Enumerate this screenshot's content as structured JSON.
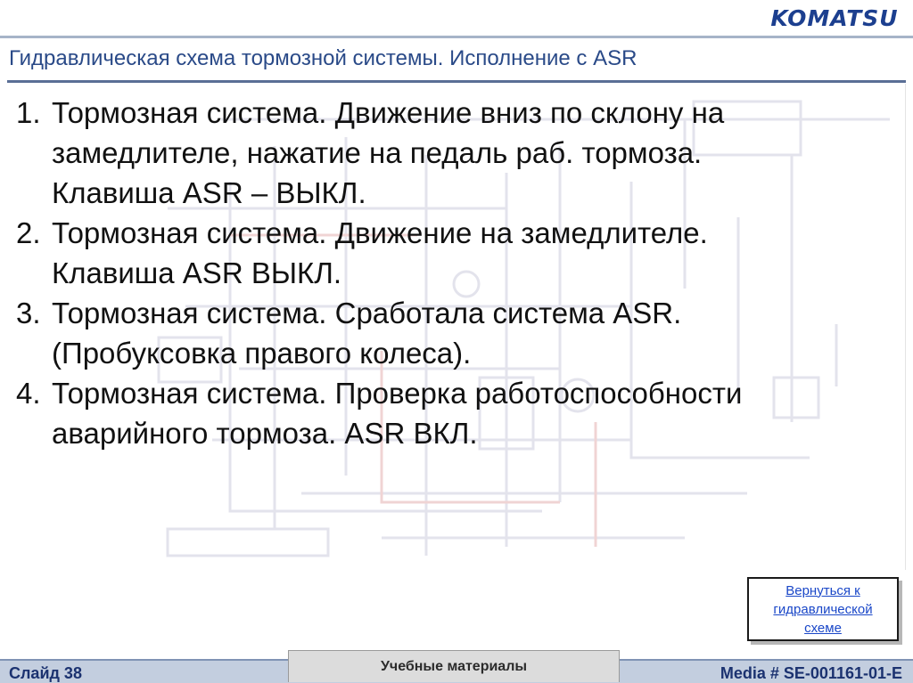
{
  "header": {
    "logo": "KOMATSU",
    "title": "Гидравлическая схема тормозной системы. Исполнение с ASR"
  },
  "items": [
    {
      "num": "1.",
      "text": "Тормозная система. Движение вниз по склону на\nзамедлителе, нажатие на педаль раб. тормоза.\nКлавиша ASR – ВЫКЛ."
    },
    {
      "num": "2.",
      "text": "Тормозная система. Движение на замедлителе.\nКлавиша ASR ВЫКЛ."
    },
    {
      "num": "3.",
      "text": "Тормозная система. Сработала система ASR.\n(Пробуксовка правого колеса)."
    },
    {
      "num": "4.",
      "text": "Тормозная система. Проверка работоспособности\nаварийного тормоза. ASR ВКЛ."
    }
  ],
  "back_link": {
    "label": "Вернуться к\nгидравлической\nсхеме"
  },
  "footer": {
    "slide": "Слайд 38",
    "materials": "Учебные материалы",
    "media": "Media # SE-001161-01-E"
  },
  "colors": {
    "title": "#2a4a88",
    "link": "#1a47c8",
    "footer_bg": "#c3cedf",
    "footer_text": "#1b3270"
  }
}
